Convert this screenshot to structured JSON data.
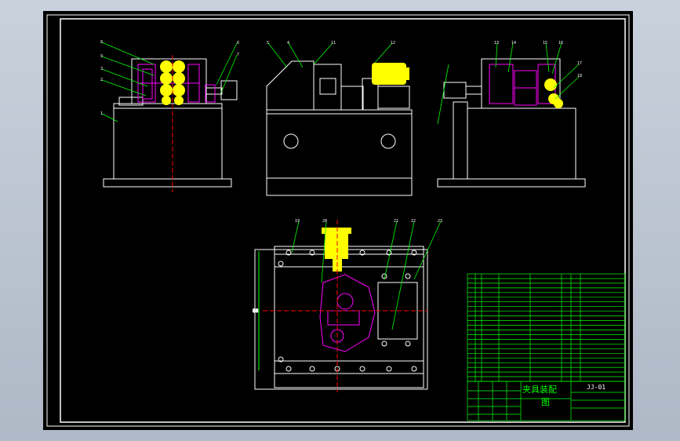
{
  "drawing": {
    "code": "JJ-01",
    "title_line1": "夹具装配",
    "title_line2": "图",
    "view_callouts_front": [
      "8",
      "9",
      "3",
      "2",
      "1",
      "6",
      "7"
    ],
    "view_callouts_side": [
      "5",
      "4",
      "11",
      "12"
    ],
    "view_callouts_right": [
      "13",
      "14",
      "15",
      "16",
      "17",
      "18"
    ],
    "view_callouts_top": [
      "19",
      "20",
      "21",
      "22",
      "23"
    ],
    "dimension": "88"
  },
  "colors": {
    "background": "#000000",
    "line": "#ffffff",
    "hidden_part": "#ff00ff",
    "highlight": "#ffff00",
    "table_line": "#00ff00",
    "callout": "#00ff00",
    "centerline": "#ff0000"
  },
  "bom_rows": 23
}
